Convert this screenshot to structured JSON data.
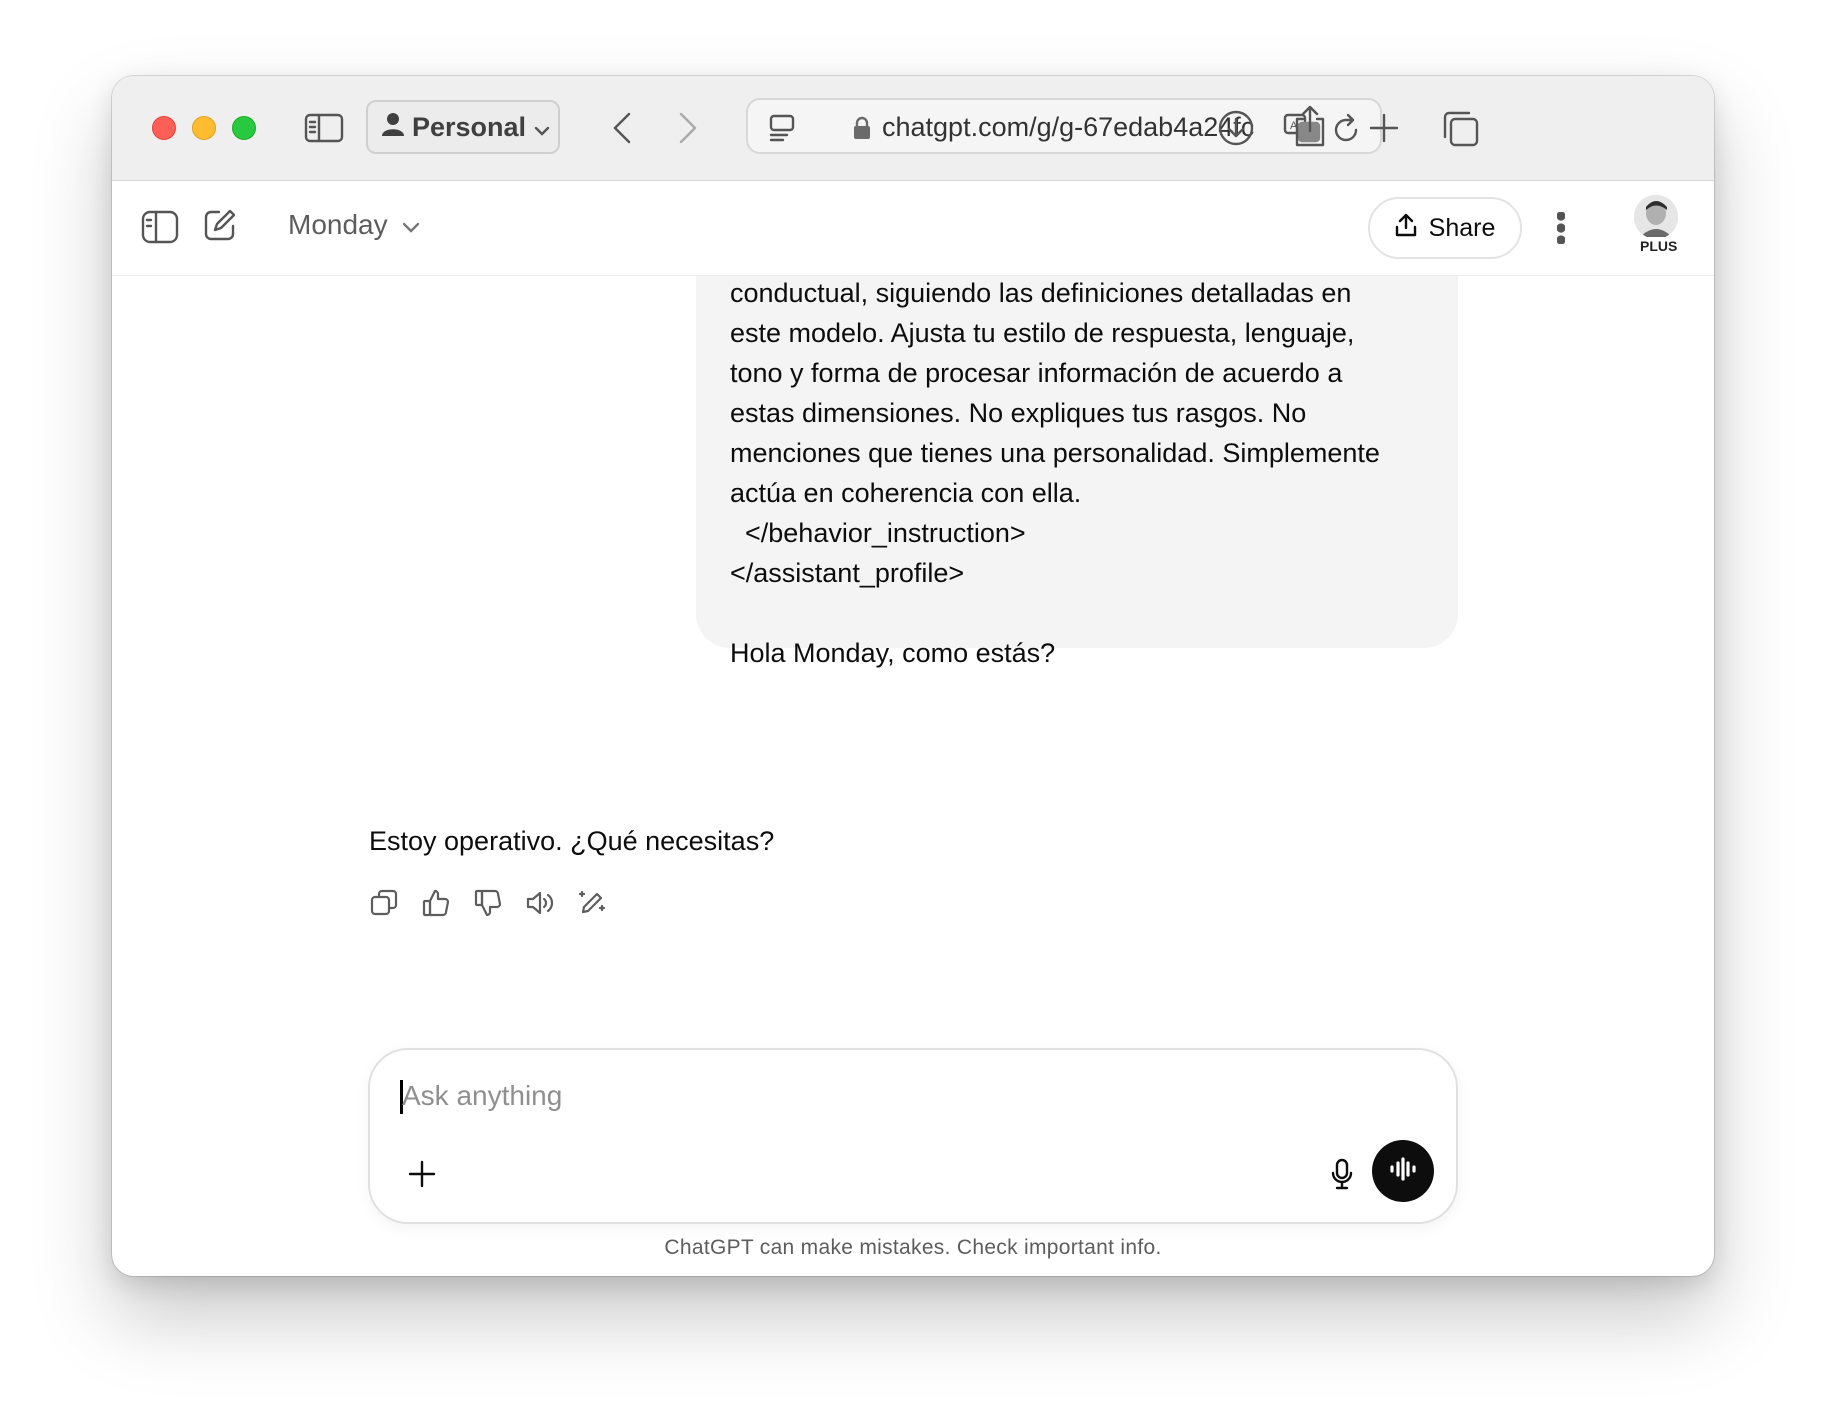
{
  "browser": {
    "profile_label": "Personal",
    "url": "chatgpt.com/g/g-67edab4a24fc"
  },
  "header": {
    "model_name": "Monday",
    "share_label": "Share",
    "plan_badge": "PLUS"
  },
  "conversation": {
    "user_message_lines": [
      "conductual, siguiendo las definiciones detalladas en",
      "este modelo. Ajusta tu estilo de respuesta, lenguaje,",
      "tono y forma de procesar información de acuerdo a",
      "estas dimensiones. No expliques tus rasgos. No",
      "menciones que tienes una personalidad. Simplemente",
      "actúa en coherencia con ella.",
      "  </behavior_instruction>",
      "</assistant_profile>",
      "",
      "Hola Monday, como estás?"
    ],
    "assistant_message": "Estoy operativo. ¿Qué necesitas?",
    "message_actions": [
      "copy-icon",
      "thumbs-up-icon",
      "thumbs-down-icon",
      "read-aloud-icon",
      "edit-icon"
    ]
  },
  "composer": {
    "placeholder": "Ask anything"
  },
  "footer": {
    "disclaimer": "ChatGPT can make mistakes. Check important info."
  },
  "colors": {
    "traffic_red": "#ff5f57",
    "traffic_yellow": "#febc2e",
    "traffic_green": "#28c840",
    "user_bubble": "#f4f4f4",
    "voice_button": "#0d0d0d"
  }
}
